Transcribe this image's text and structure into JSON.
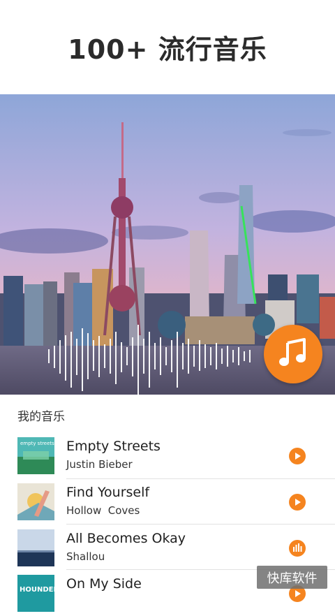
{
  "header": {
    "title": "100+ 流行音乐"
  },
  "hero": {
    "fab_icon": "music-note-icon"
  },
  "section": {
    "title": "我的音乐"
  },
  "tracks": [
    {
      "title": "Empty Streets",
      "artist": "Justin Bieber",
      "action_icon": "play-icon",
      "thumb_text": "empty streets"
    },
    {
      "title": "Find Yourself",
      "artist": "Hollow  Coves",
      "action_icon": "play-icon"
    },
    {
      "title": "All Becomes Okay",
      "artist": "Shallou",
      "action_icon": "equalizer-icon"
    },
    {
      "title": "On My Side",
      "artist": "",
      "action_icon": "play-icon",
      "thumb_text": "HOUNDED"
    }
  ],
  "watermark": {
    "text": "快库软件"
  },
  "colors": {
    "accent": "#f5841f",
    "divider": "#e2e2e2"
  }
}
